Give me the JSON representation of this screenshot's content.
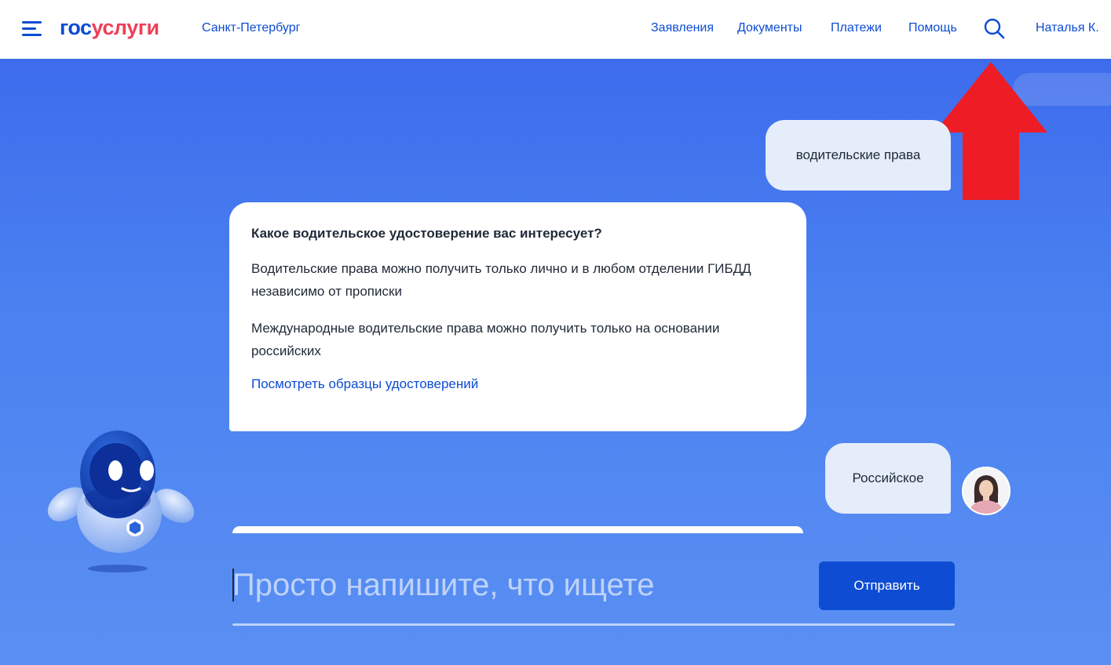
{
  "header": {
    "logo_part1": "гос",
    "logo_part2": "услуги",
    "region": "Санкт-Петербург",
    "nav": [
      "Заявления",
      "Документы",
      "Платежи",
      "Помощь"
    ],
    "user_name": "Наталья К."
  },
  "chat": {
    "user_message_1": "водительские права",
    "bot_title": "Какое водительское удостоверение вас интересует?",
    "bot_paragraph_1": "Водительские права можно получить только лично и в любом отделении ГИБДД независимо от прописки",
    "bot_paragraph_2": "Международные водительские права можно получить только на основании российских",
    "bot_link": "Посмотреть образцы удостоверений",
    "user_message_2": "Российское"
  },
  "input": {
    "placeholder": "Просто напишите, что ищете",
    "value": "",
    "send_label": "Отправить"
  },
  "icons": {
    "menu": "menu-icon",
    "search": "search-icon",
    "avatar": "user-avatar",
    "robot": "robot-assistant-illustration",
    "annotation": "red-arrow-up"
  },
  "colors": {
    "brand_blue": "#0d4cd3",
    "brand_red": "#ee3f58",
    "background_top": "#3a67ec",
    "background_bottom": "#5a90f2",
    "user_bubble": "#e5ecfa",
    "annotation_arrow": "#ee1c25"
  }
}
